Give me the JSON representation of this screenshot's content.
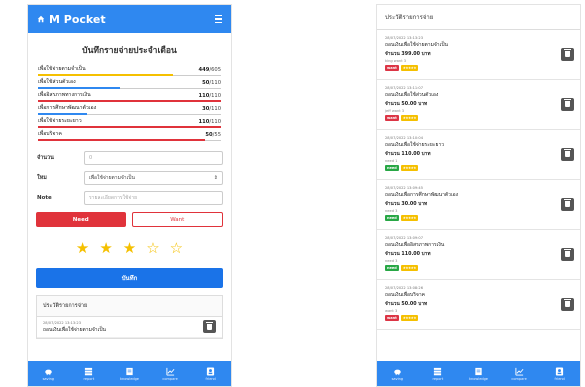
{
  "app": {
    "name": "M Pocket"
  },
  "page_title": "บันทึกรายจ่ายประจำเดือน",
  "budgets": [
    {
      "label": "เพื่อใช้จ่ายตามจำเป็น",
      "spent": "449",
      "total": "/605",
      "color": "#f5c000",
      "ratio": 0.74
    },
    {
      "label": "เพื่อใช้ส่วนตัวเอง",
      "spent": "50",
      "total": "/110",
      "color": "#2f88f0",
      "ratio": 0.45
    },
    {
      "label": "เพื่ออิสรภาพทางการเงิน",
      "spent": "110",
      "total": "/110",
      "color": "#e0333b",
      "ratio": 1.0
    },
    {
      "label": "เพื่อการศึกษาพัฒนาตัวเอง",
      "spent": "30",
      "total": "/110",
      "color": "#2f88f0",
      "ratio": 0.27
    },
    {
      "label": "เพื่อใช้จ่ายระยะยาว",
      "spent": "110",
      "total": "/110",
      "color": "#e0333b",
      "ratio": 1.0
    },
    {
      "label": "เพื่อบริจาค",
      "spent": "50",
      "total": "/55",
      "color": "#e0333b",
      "ratio": 0.91
    }
  ],
  "form": {
    "amount_label": "จำนวน",
    "amount_placeholder": "0",
    "type_label": "ใหม",
    "type_value": "เพื่อใช้จ่ายตามจำเป็น",
    "note_label": "Note",
    "note_placeholder": "รายละเอียดการใช้จ่าย",
    "need_label": "Need",
    "want_label": "Want",
    "rating": 3,
    "rating_max": 5,
    "save_label": "บันทึก"
  },
  "history": {
    "title": "ประวัติรายการจ่าย",
    "left_preview": {
      "date": "28/07/2022 13:13:23",
      "name": "ถอนเงินเพื่อใช้จ่ายตามจำเป็น"
    },
    "items": [
      {
        "date": "28/07/2022 13:13:23",
        "name": "ถอนเงินเพื่อใช้จ่ายตามจำเป็น",
        "amount": "จำนวน 399.00 บาท",
        "user": "king want 3",
        "tag": "want",
        "stars": "★★★★★"
      },
      {
        "date": "28/07/2022 13:11:07",
        "name": "ถอนเงินเพื่อใช้ส่วนตัวเอง",
        "amount": "จำนวน 50.00 บาท",
        "user": "jeff want 3",
        "tag": "want",
        "stars": "★★★★★"
      },
      {
        "date": "28/07/2022 13:10:04",
        "name": "ถอนเงินเพื่อใช้จ่ายระยะยาว",
        "amount": "จำนวน 110.00 บาท",
        "user": "need 1",
        "tag": "need",
        "stars": "★★★★★"
      },
      {
        "date": "28/07/2022 13:09:45",
        "name": "ถอนเงินเพื่อการศึกษาพัฒนาตัวเอง",
        "amount": "จำนวน 30.00 บาท",
        "user": "need 3",
        "tag": "need",
        "stars": "★★★★★"
      },
      {
        "date": "28/07/2022 13:09:07",
        "name": "ถอนเงินเพื่ออิสรภาพการเงิน",
        "amount": "จำนวน 110.00 บาท",
        "user": "need 3",
        "tag": "need",
        "stars": "★★★★★"
      },
      {
        "date": "28/07/2022 13:08:26",
        "name": "ถอนเงินเพื่อบริจาค",
        "amount": "จำนวน 50.00 บาท",
        "user": "want 3",
        "tag": "want",
        "stars": "★★★★★"
      }
    ]
  },
  "nav": [
    {
      "label": "saving",
      "icon": "piggy-bank-icon"
    },
    {
      "label": "report",
      "icon": "stack-icon"
    },
    {
      "label": "knowledge",
      "icon": "book-icon"
    },
    {
      "label": "compare",
      "icon": "chart-icon"
    },
    {
      "label": "friend",
      "icon": "user-icon"
    }
  ],
  "colors": {
    "primary": "#2f88f0",
    "danger": "#e0333b",
    "success": "#28a745",
    "star": "#f5c000"
  }
}
